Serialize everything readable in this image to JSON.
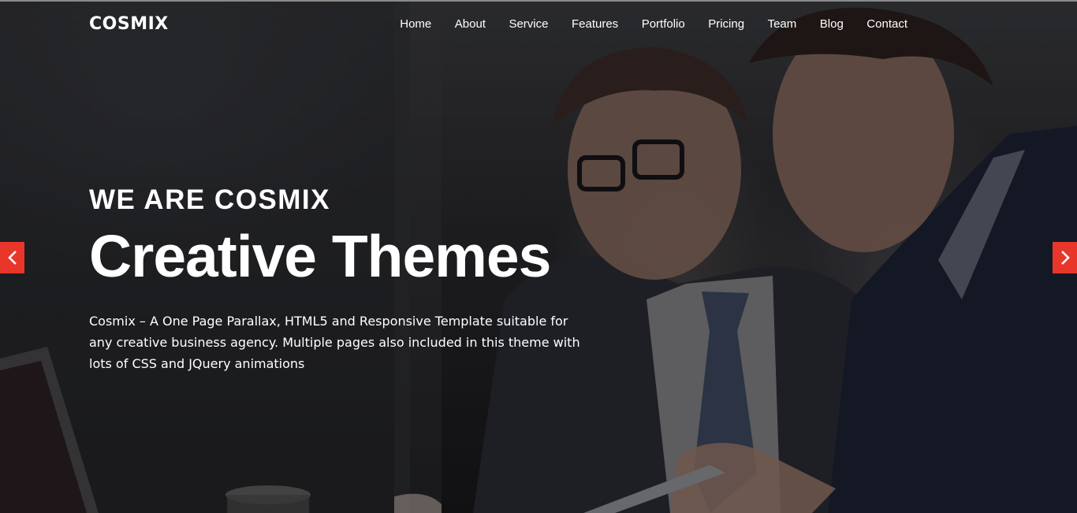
{
  "brand": {
    "logo": "COSMIX"
  },
  "nav": {
    "items": [
      {
        "label": "Home"
      },
      {
        "label": "About"
      },
      {
        "label": "Service"
      },
      {
        "label": "Features"
      },
      {
        "label": "Portfolio"
      },
      {
        "label": "Pricing"
      },
      {
        "label": "Team"
      },
      {
        "label": "Blog"
      },
      {
        "label": "Contact"
      }
    ]
  },
  "hero": {
    "eyebrow": "WE ARE COSMIX",
    "headline": "Creative Themes",
    "description": "Cosmix – A One Page Parallax, HTML5 and Responsive Template suitable for any creative business agency. Multiple pages also included in this theme with lots of CSS and JQuery animations",
    "background_image": "two businessmen in suits looking at a tablet"
  },
  "slider": {
    "prev_icon": "chevron-left-icon",
    "next_icon": "chevron-right-icon"
  },
  "colors": {
    "accent": "#e8362a",
    "text": "#ffffff",
    "overlay": "#1c1c1e"
  }
}
